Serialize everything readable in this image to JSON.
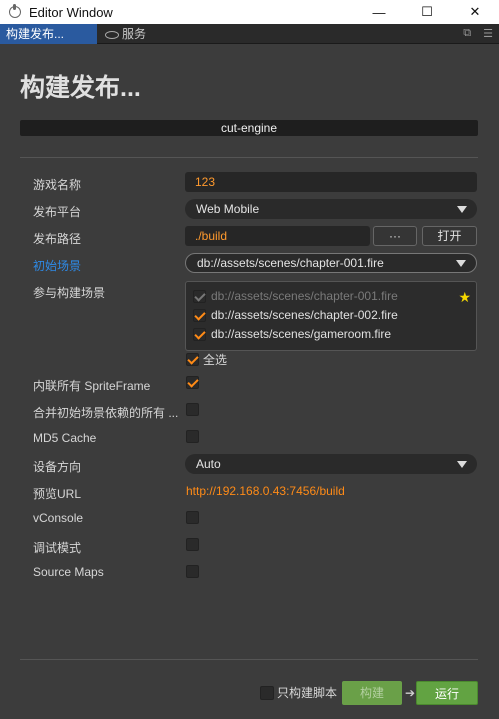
{
  "window": {
    "title": "Editor Window",
    "minimize_glyph": "—",
    "maximize_glyph": "☐",
    "close_glyph": "✕"
  },
  "tabs": {
    "active_label": "构建发布...",
    "service_label": "服务"
  },
  "page": {
    "title": "构建发布...",
    "project_name": "cut-engine"
  },
  "form": {
    "game_name_label": "游戏名称",
    "game_name_value": "123",
    "platform_label": "发布平台",
    "platform_value": "Web Mobile",
    "path_label": "发布路径",
    "path_value": "./build",
    "path_browse_label": "···",
    "path_open_label": "打开",
    "start_scene_label": "初始场景",
    "start_scene_value": "db://assets/scenes/chapter-001.fire",
    "scenes_label": "参与构建场景",
    "scenes": [
      {
        "path": "db://assets/scenes/chapter-001.fire",
        "checked": true,
        "disabled": true
      },
      {
        "path": "db://assets/scenes/chapter-002.fire",
        "checked": true,
        "disabled": false
      },
      {
        "path": "db://assets/scenes/gameroom.fire",
        "checked": true,
        "disabled": false
      }
    ],
    "select_all_label": "全选",
    "inline_spriteframe_label": "内联所有 SpriteFrame",
    "merge_deps_label": "合并初始场景依赖的所有 ...",
    "md5_label": "MD5 Cache",
    "orientation_label": "设备方向",
    "orientation_value": "Auto",
    "preview_url_label": "预览URL",
    "preview_url_value": "http://192.168.0.43:7456/build",
    "vconsole_label": "vConsole",
    "debug_label": "调试模式",
    "sourcemaps_label": "Source Maps"
  },
  "footer": {
    "script_only_label": "只构建脚本",
    "build_label": "构建",
    "run_label": "运行"
  },
  "colors": {
    "accent_orange": "#ff8b17",
    "highlight_blue": "#2e8ae6",
    "tab_active": "#2a5a9f",
    "run_green": "#62a342"
  }
}
